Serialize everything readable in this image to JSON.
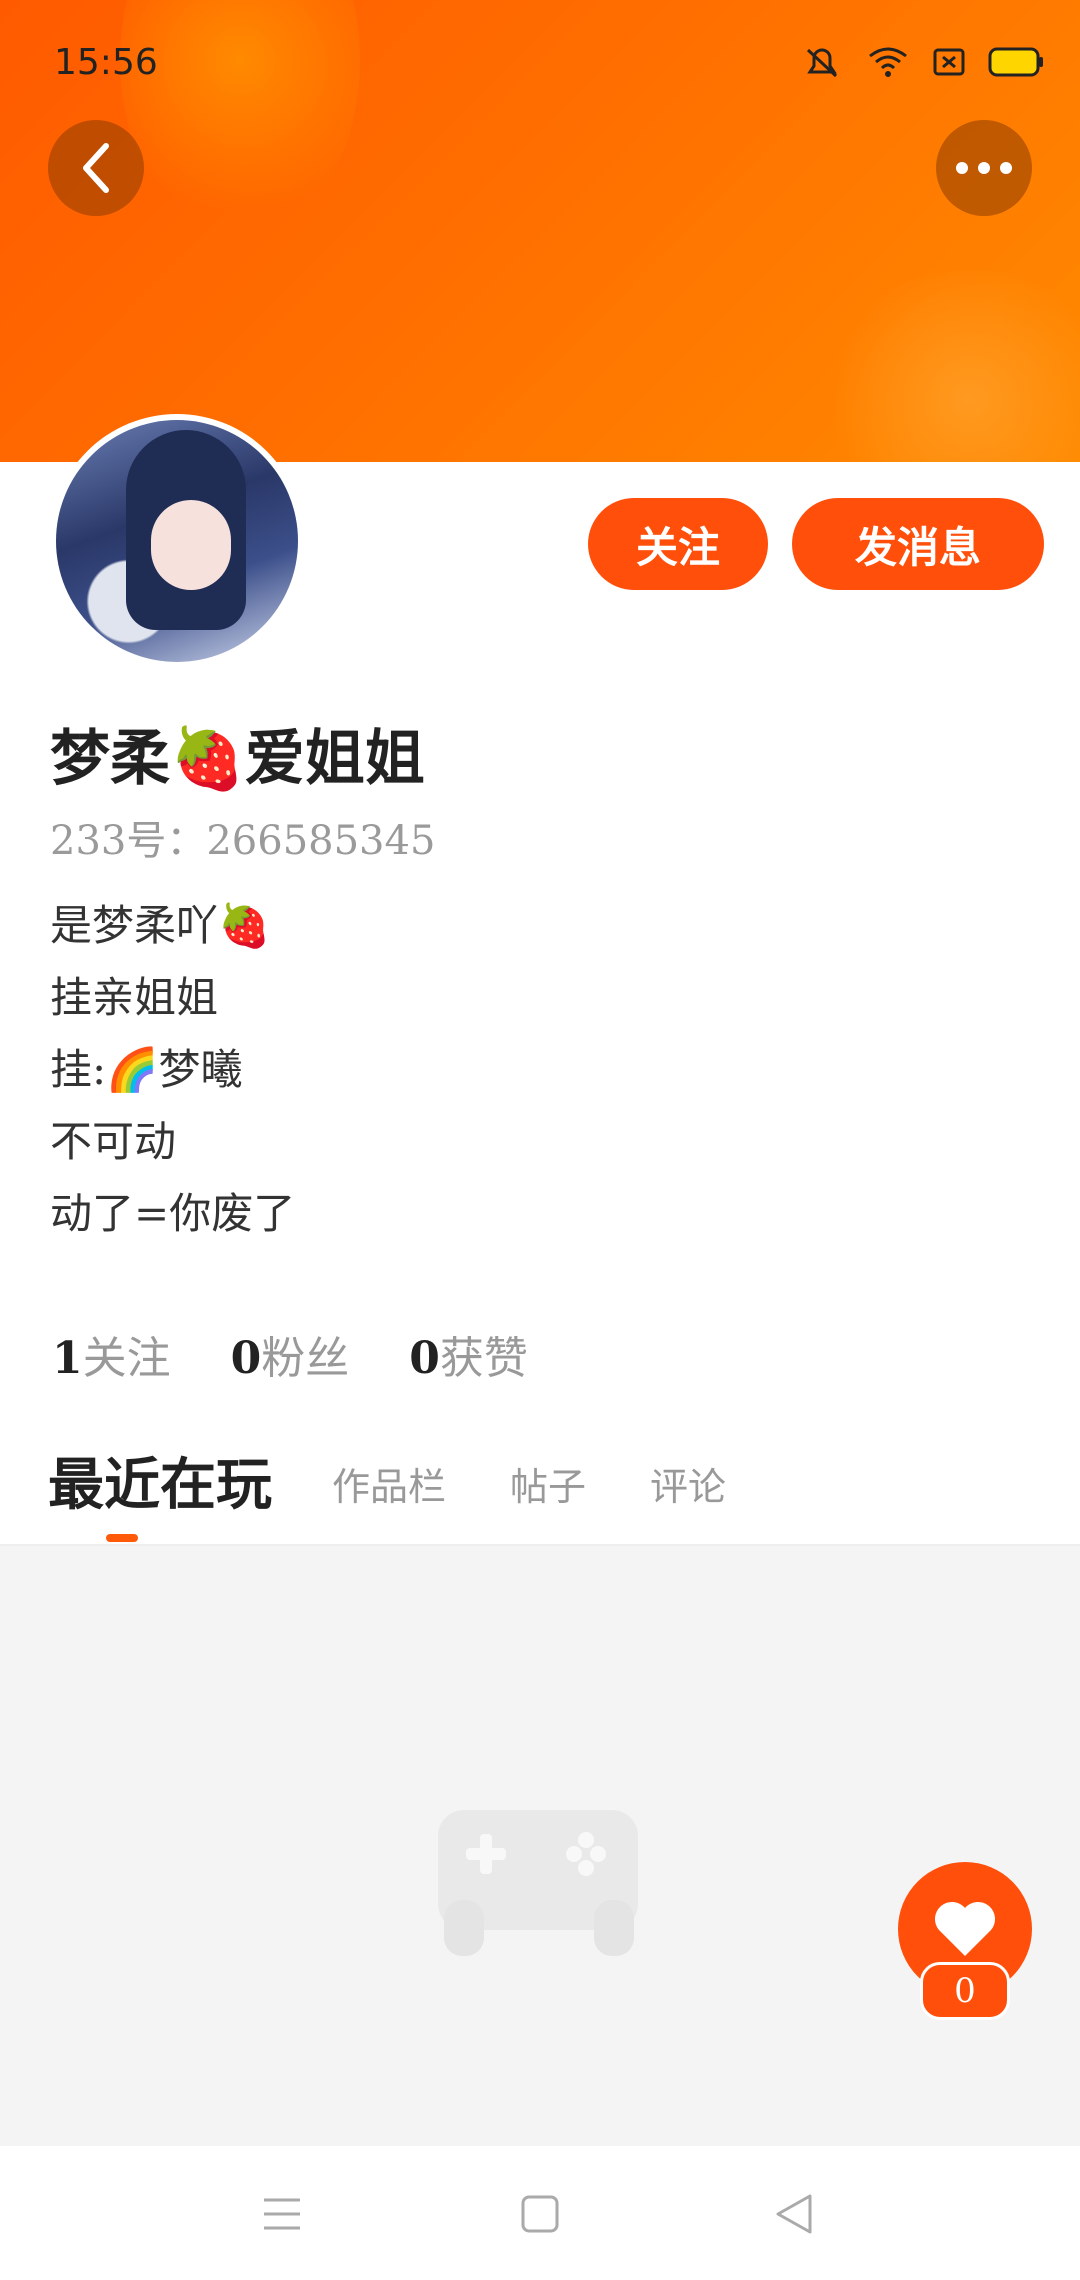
{
  "status_bar": {
    "time": "15:56"
  },
  "header": {
    "follow_label": "关注",
    "message_label": "发消息"
  },
  "profile": {
    "name": "梦柔🍓爱姐姐",
    "uid": "233号：266585345",
    "bio": [
      "是梦柔吖🍓",
      "挂亲姐姐",
      "挂:🌈梦曦",
      "不可动",
      "动了=你废了"
    ]
  },
  "stats": [
    {
      "num": "1",
      "label": "关注"
    },
    {
      "num": "0",
      "label": "粉丝"
    },
    {
      "num": "0",
      "label": "获赞"
    }
  ],
  "tabs": {
    "active": "最近在玩",
    "others": [
      "作品栏",
      "帖子",
      "评论"
    ]
  },
  "like": {
    "count": "0"
  },
  "colors": {
    "accent": "#ff4f0a",
    "banner_start": "#ff5a00",
    "banner_end": "#ff8a00"
  },
  "icons": [
    "back-arrow-icon",
    "more-dots-icon",
    "mute-icon",
    "wifi-icon",
    "sim-icon",
    "battery-icon",
    "controller-icon",
    "heart-icon",
    "menu-icon",
    "home-square-icon",
    "back-triangle-icon"
  ]
}
